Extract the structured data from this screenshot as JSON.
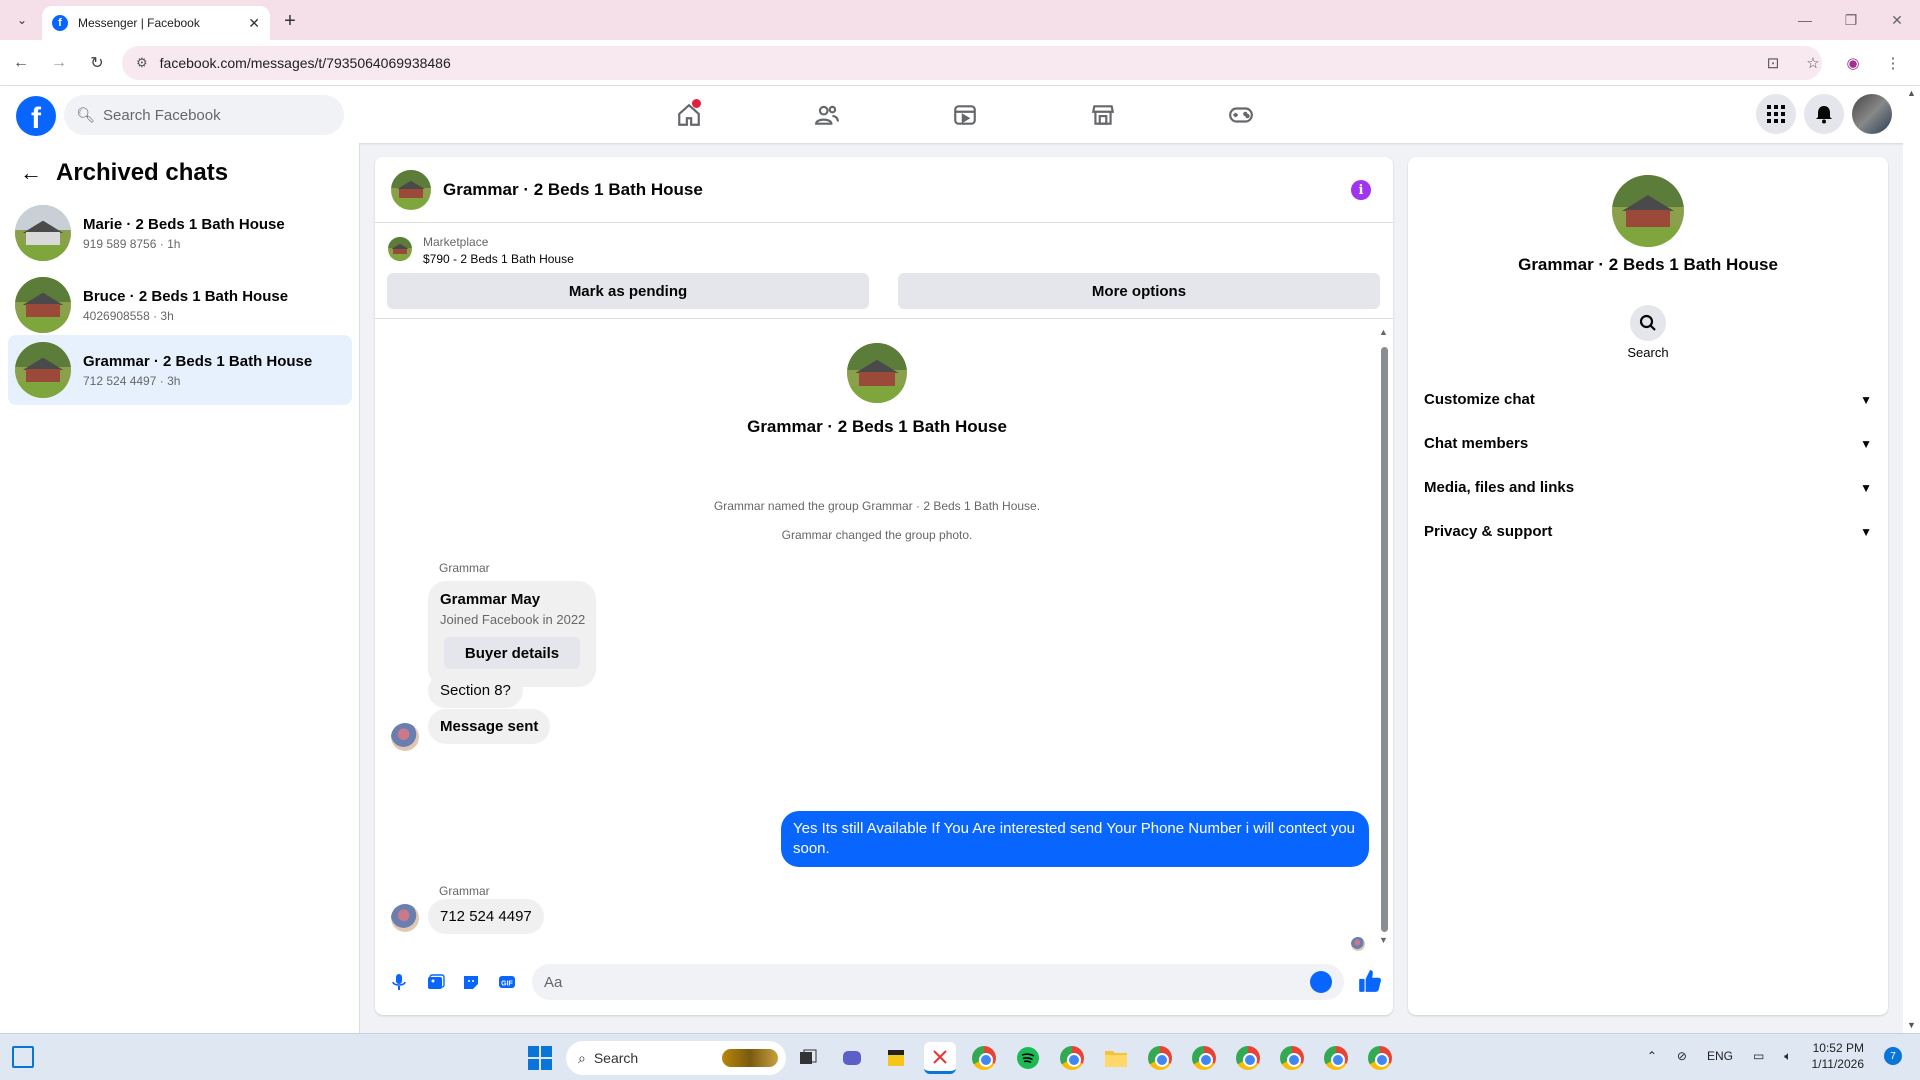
{
  "browser": {
    "tab_title": "Messenger | Facebook",
    "url": "facebook.com/messages/t/7935064069938486"
  },
  "fb": {
    "search_placeholder": "Search Facebook",
    "logo": "f"
  },
  "left": {
    "title": "Archived chats",
    "chats": [
      {
        "name": "Marie · 2 Beds 1 Bath House",
        "sub": "919 589 8756 · 1h"
      },
      {
        "name": "Bruce · 2 Beds 1 Bath House",
        "sub": "4026908558 · 3h"
      },
      {
        "name": "Grammar · 2 Beds 1 Bath House",
        "sub": "712 524 4497 · 3h"
      }
    ]
  },
  "chat": {
    "title": "Grammar · 2 Beds 1 Bath House",
    "info_icon": "i",
    "marketplace_label": "Marketplace",
    "listing": "$790 - 2 Beds 1 Bath House",
    "mark_pending": "Mark as pending",
    "more_options": "More options",
    "header_name": "Grammar · 2 Beds 1 Bath House",
    "system_1": "Grammar named the group Grammar · 2 Beds 1 Bath House.",
    "system_2": "Grammar changed the group photo.",
    "sender_1": "Grammar",
    "card_name": "Grammar May",
    "card_sub": "Joined Facebook in 2022",
    "card_button": "Buyer details",
    "msg_1": "Section 8?",
    "msg_2": "Message sent",
    "msg_out": "Yes Its still Available If You Are interested send Your Phone Number i will contect you soon.",
    "sender_2": "Grammar",
    "msg_3": "712 524 4497",
    "composer_placeholder": "Aa"
  },
  "right": {
    "name": "Grammar · 2 Beds 1 Bath House",
    "search_label": "Search",
    "sections": [
      "Customize chat",
      "Chat members",
      "Media, files and links",
      "Privacy & support"
    ]
  },
  "taskbar": {
    "search": "Search",
    "lang": "ENG",
    "time": "10:52 PM",
    "date": "1/11/2026",
    "notif_count": "7"
  },
  "colors": {
    "accent": "#0866ff",
    "active_chat": "#e7f1fd",
    "info": "#a034f0",
    "notification_dot": "#e41e3f"
  }
}
